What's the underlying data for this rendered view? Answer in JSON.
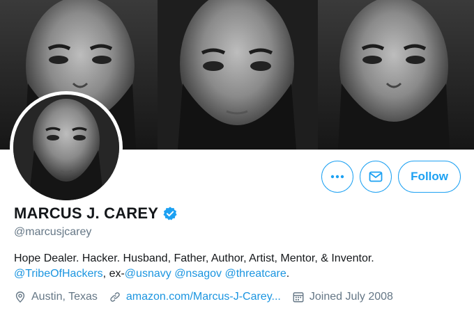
{
  "profile": {
    "display_name": "MARCUS J. CAREY",
    "handle": "@marcusjcarey",
    "verified_icon": "verified-badge-icon",
    "bio": {
      "line1": "Hope Dealer. Hacker. Husband, Father, Author, Artist, Mentor, & Inventor.",
      "mention_tribe": "@TribeOfHackers",
      "sep_ex": ", ex-",
      "mention_usnavy": "@usnavy",
      "mention_nsagov": "@nsagov",
      "mention_threatcare": "@threatcare",
      "end_period": "."
    },
    "location": "Austin, Texas",
    "website": "amazon.com/Marcus-J-Carey...",
    "joined": "Joined July 2008"
  },
  "actions": {
    "more_icon": "more-icon",
    "message_icon": "envelope-icon",
    "follow_label": "Follow"
  },
  "colors": {
    "accent": "#1da1f2",
    "link": "#1b95e0",
    "secondary_text": "#657786"
  }
}
